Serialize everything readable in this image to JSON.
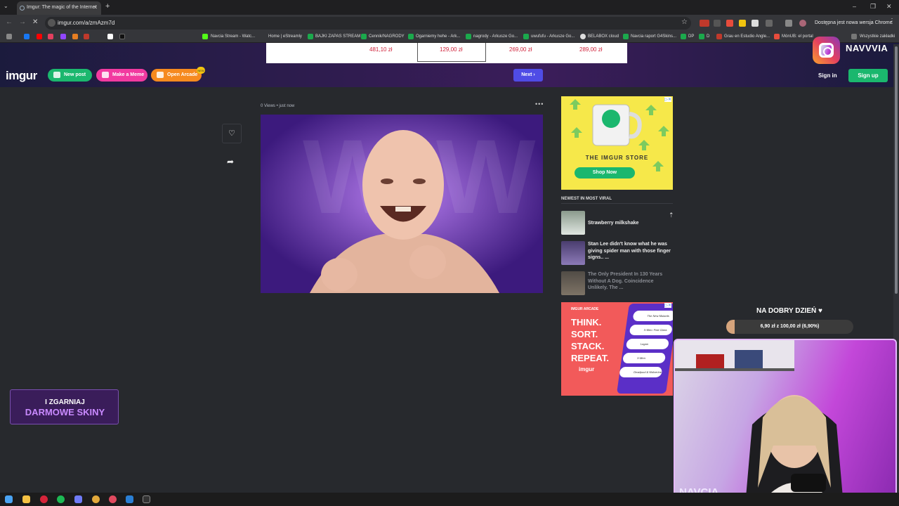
{
  "browser": {
    "tab_title": "Imgur: The magic of the Internet",
    "url": "imgur.com/a/zmAzm7d",
    "update_notice": "Dostępna jest nowa wersja Chrome",
    "bookmarks": [
      "Navcia Stream - Watc...",
      "Home | eStreamly",
      "BAJKI ZAPAS STREAM",
      "Cennik/NAGRODY",
      "Ogarniemy hehe - Ark...",
      "nagrody - Arkusze Go...",
      "uwufufu - Arkusze Go...",
      "BELABOX cloud",
      "Navcia raport G4Skins...",
      "DP",
      "D",
      "Grau en Estudio Angle...",
      "MónUB: el portal",
      "Wszystkie zakładki"
    ]
  },
  "ad_strip": {
    "prices": [
      "481,10 zł",
      "129,00 zł",
      "269,00 zł",
      "289,00 zł"
    ]
  },
  "header": {
    "logo": "imgur",
    "new_post": "New post",
    "make_meme": "Make a Meme",
    "open_arcade": "Open Arcade",
    "arcade_badge": "NEW",
    "next": "Next",
    "sign_in": "Sign in",
    "sign_up": "Sign up"
  },
  "post": {
    "views": "0 Views",
    "time": "just now"
  },
  "store_ad": {
    "title": "THE IMGUR STORE",
    "cta": "Shop Now"
  },
  "viral": {
    "heading": "NEWEST IN MOST VIRAL",
    "items": [
      {
        "title": "Strawberry milkshake"
      },
      {
        "title": "Stan Lee didn't know what he was giving spider man with those finger signs.. ..."
      },
      {
        "title": "The Only President In 130 Years Without A Dog. Coincidence Unlikely. The ..."
      }
    ]
  },
  "arcade_ad": {
    "label": "IMGUR ARCADE",
    "lines": [
      "THINK.",
      "SORT.",
      "STACK.",
      "REPEAT."
    ],
    "brand": "imgur",
    "games": [
      "The New Mutants",
      "X-Men: First Class",
      "Logan",
      "X-Men",
      "Deadpool & Wolverine"
    ]
  },
  "overlay": {
    "free_skins_1": "I ZGARNIAJ",
    "free_skins_2": "DARMOWE SKINY",
    "ig_handle": "NAVVVIA",
    "greeting": "NA DOBRY DZIEŃ ♥",
    "goal_text": "6,90 zł z 100,00 zł (6,90%)",
    "goal_fraction": 0.069,
    "cam_name": "NAVCIA"
  },
  "colors": {
    "green": "#1bb76e",
    "pink": "#f23aa0",
    "orange": "#f68a1f",
    "next": "#4f4ce6"
  }
}
